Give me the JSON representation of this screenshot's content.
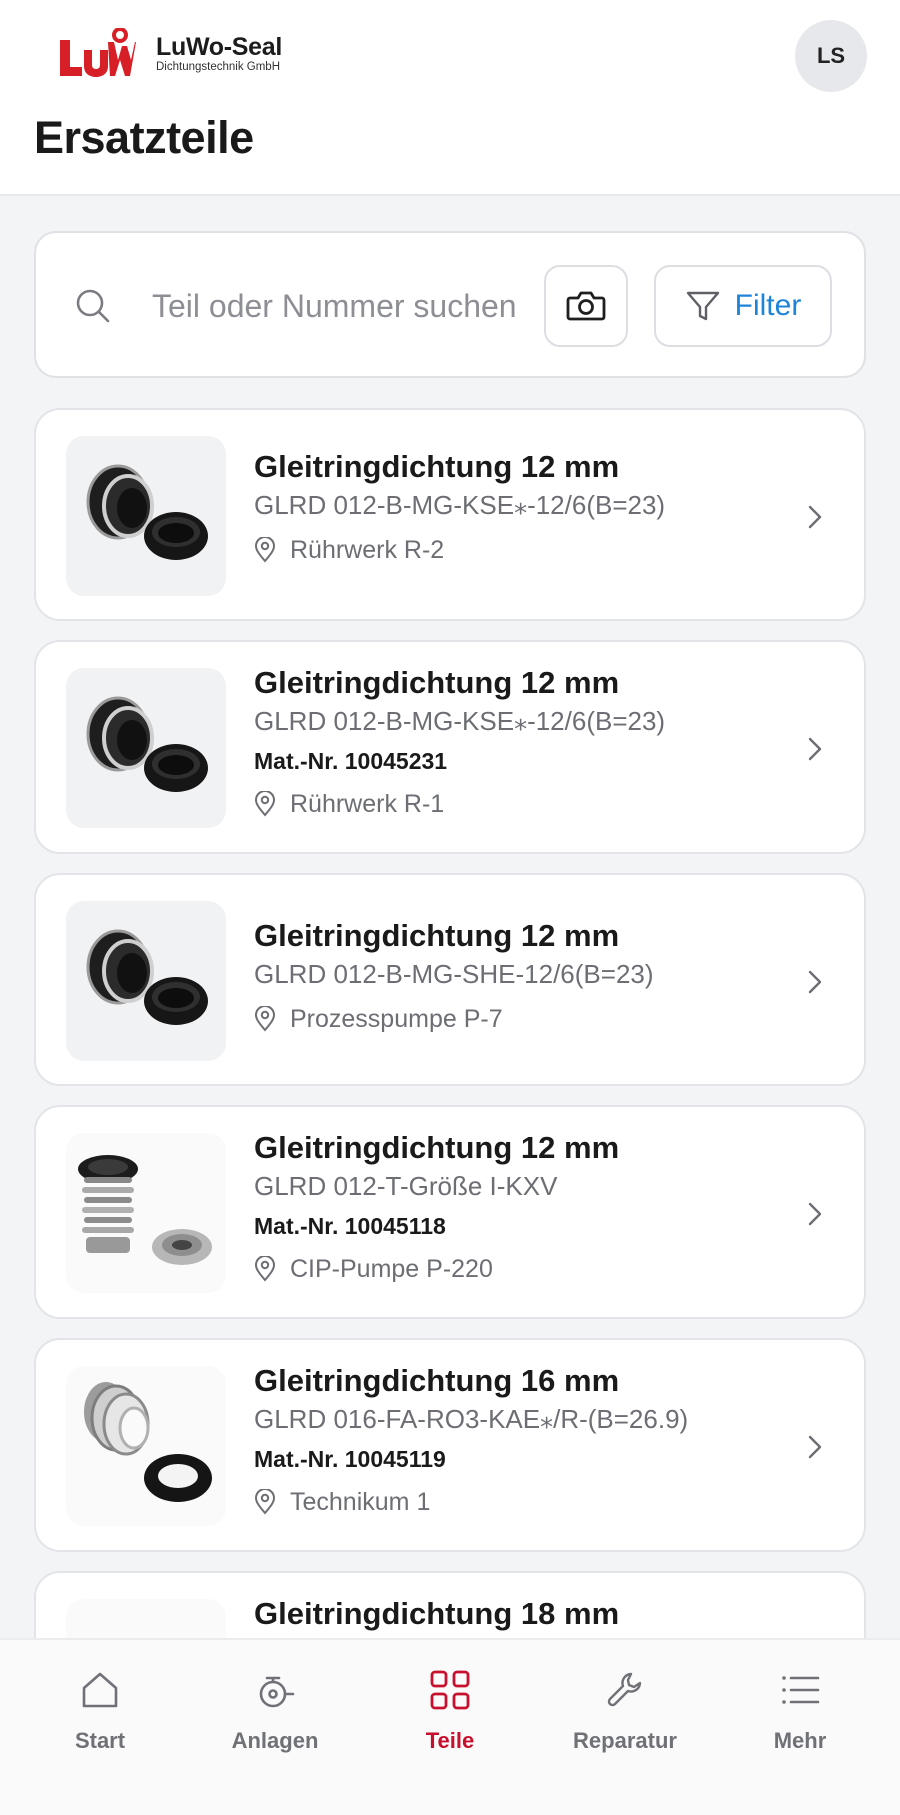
{
  "header": {
    "logo_name": "LuWo-Seal",
    "logo_sub": "Dichtungstechnik GmbH",
    "logo_mark_text": "LuW",
    "avatar_initials": "LS",
    "title": "Ersatzteile"
  },
  "search": {
    "placeholder": "Teil oder Nummer suchen",
    "value": "",
    "filter_label": "Filter"
  },
  "parts": [
    {
      "title": "Gleitringdichtung 12 mm",
      "code": "GLRD 012-B-MG-KSE⁎-12/6(B=23)",
      "mat_nr": "",
      "location": "Rührwerk R-2",
      "image": "double-seal-black"
    },
    {
      "title": "Gleitringdichtung 12 mm",
      "code": "GLRD 012-B-MG-KSE⁎-12/6(B=23)",
      "mat_nr": "Mat.-Nr. 10045231",
      "location": "Rührwerk R-1",
      "image": "double-seal-black"
    },
    {
      "title": "Gleitringdichtung 12 mm",
      "code": "GLRD 012-B-MG-SHE-12/6(B=23)",
      "mat_nr": "",
      "location": "Prozesspumpe P-7",
      "image": "double-seal-black"
    },
    {
      "title": "Gleitringdichtung 12 mm",
      "code": "GLRD 012-T-Größe I-KXV",
      "mat_nr": "Mat.-Nr. 10045118",
      "location": "CIP-Pumpe P-220",
      "image": "spring-seal-steel"
    },
    {
      "title": "Gleitringdichtung 16 mm",
      "code": "GLRD 016-FA-RO3-KAE⁎/R-(B=26.9)",
      "mat_nr": "Mat.-Nr. 10045119",
      "location": "Technikum 1",
      "image": "bellows-seal-steel"
    },
    {
      "title": "Gleitringdichtung 18 mm",
      "code": "",
      "mat_nr": "",
      "location": "",
      "image": ""
    }
  ],
  "nav": [
    {
      "label": "Start",
      "icon": "home-icon",
      "active": false
    },
    {
      "label": "Anlagen",
      "icon": "pump-icon",
      "active": false
    },
    {
      "label": "Teile",
      "icon": "grid-icon",
      "active": true
    },
    {
      "label": "Reparatur",
      "icon": "wrench-icon",
      "active": false
    },
    {
      "label": "Mehr",
      "icon": "menu-list-icon",
      "active": false
    }
  ],
  "colors": {
    "brand_red": "#c8102e",
    "accent_blue": "#1d84d8",
    "background": "#f3f4f6"
  }
}
